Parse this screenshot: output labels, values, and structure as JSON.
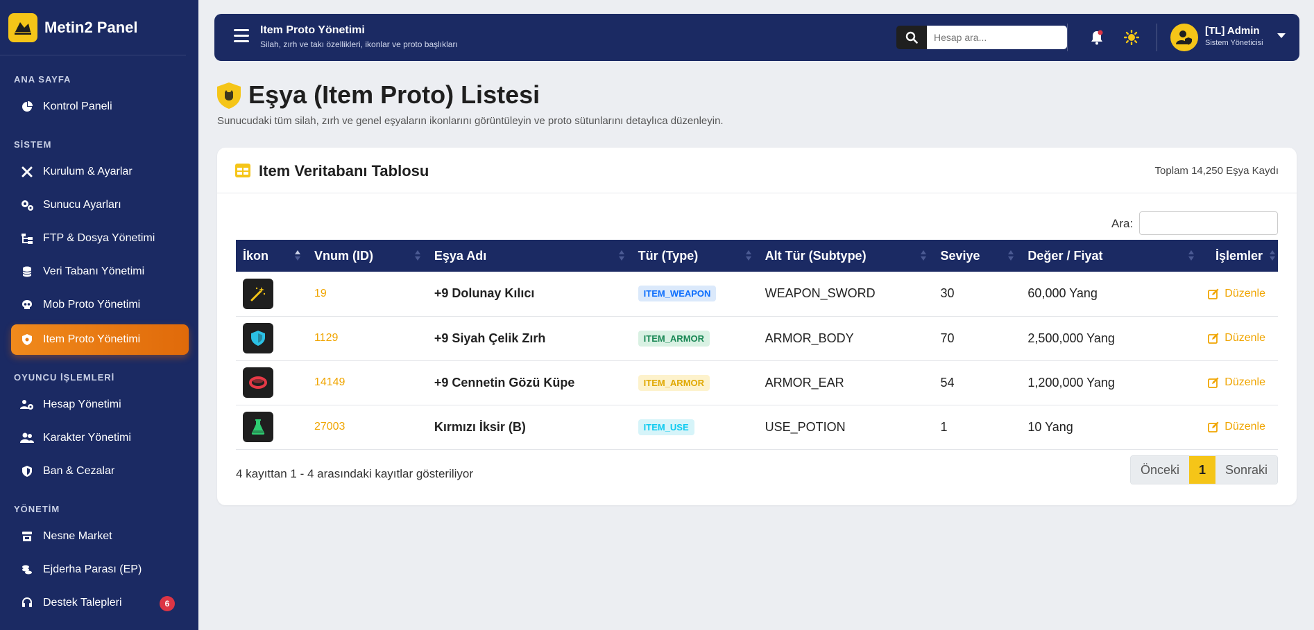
{
  "brand": {
    "name": "Metin2 Panel"
  },
  "sidebar": {
    "sections": [
      {
        "label": "ANA SAYFA"
      },
      {
        "label": "SİSTEM"
      },
      {
        "label": "OYUNCU İŞLEMLERİ"
      },
      {
        "label": "YÖNETİM"
      }
    ],
    "items": [
      {
        "label": "Kontrol Paneli",
        "icon": "chart-pie-icon"
      },
      {
        "label": "Kurulum & Ayarlar",
        "icon": "tools-icon"
      },
      {
        "label": "Sunucu Ayarları",
        "icon": "gears-icon"
      },
      {
        "label": "FTP & Dosya Yönetimi",
        "icon": "folder-tree-icon"
      },
      {
        "label": "Veri Tabanı Yönetimi",
        "icon": "database-icon"
      },
      {
        "label": "Mob Proto Yönetimi",
        "icon": "skull-icon"
      },
      {
        "label": "Item Proto Yönetimi",
        "icon": "shield-cat-icon",
        "active": true
      },
      {
        "label": "Hesap Yönetimi",
        "icon": "users-gear-icon"
      },
      {
        "label": "Karakter Yönetimi",
        "icon": "user-group-icon"
      },
      {
        "label": "Ban & Cezalar",
        "icon": "shield-half-icon"
      },
      {
        "label": "Nesne Market",
        "icon": "store-icon"
      },
      {
        "label": "Ejderha Parası (EP)",
        "icon": "coins-icon"
      },
      {
        "label": "Destek Talepleri",
        "icon": "headset-icon",
        "badge": "6"
      }
    ]
  },
  "topbar": {
    "title": "Item Proto Yönetimi",
    "subtitle": "Silah, zırh ve takı özellikleri, ikonlar ve proto başlıkları",
    "search_placeholder": "Hesap ara...",
    "user_name": "[TL] Admin",
    "user_role": "Sistem Yöneticisi"
  },
  "page": {
    "title": "Eşya (Item Proto) Listesi",
    "description": "Sunucudaki tüm silah, zırh ve genel eşyaların ikonlarını görüntüleyin ve proto sütunlarını detaylıca düzenleyin."
  },
  "card": {
    "title": "Item Veritabanı Tablosu",
    "count": "Toplam 14,250 Eşya Kaydı",
    "filter_label": "Ara:"
  },
  "table": {
    "headers": [
      "İkon",
      "Vnum (ID)",
      "Eşya Adı",
      "Tür (Type)",
      "Alt Tür (Subtype)",
      "Seviye",
      "Değer / Fiyat",
      "İşlemler"
    ],
    "rows": [
      {
        "icon": "magic-wand-icon",
        "vnum": "19",
        "name": "+9 Dolunay Kılıcı",
        "type": "ITEM_WEAPON",
        "subtype": "WEAPON_SWORD",
        "level": "30",
        "price": "60,000 Yang",
        "action": "Düzenle"
      },
      {
        "icon": "shield-icon",
        "vnum": "1129",
        "name": "+9 Siyah Çelik Zırh",
        "type": "ITEM_ARMOR",
        "subtype": "ARMOR_BODY",
        "level": "70",
        "price": "2,500,000 Yang",
        "action": "Düzenle"
      },
      {
        "icon": "ring-icon",
        "vnum": "14149",
        "name": "+9 Cennetin Gözü Küpe",
        "type": "ITEM_ARMOR",
        "subtype": "ARMOR_EAR",
        "level": "54",
        "price": "1,200,000 Yang",
        "action": "Düzenle"
      },
      {
        "icon": "flask-icon",
        "vnum": "27003",
        "name": "Kırmızı İksir (B)",
        "type": "ITEM_USE",
        "subtype": "USE_POTION",
        "level": "1",
        "price": "10 Yang",
        "action": "Düzenle"
      }
    ]
  },
  "footer": {
    "info": "4 kayıttan 1 - 4 arasındaki kayıtlar gösteriliyor",
    "prev": "Önceki",
    "page": "1",
    "next": "Sonraki"
  },
  "colors": {
    "navy": "#1b2a63",
    "accent": "#f5c518",
    "active_nav": "#e8780f",
    "link": "#f0a500",
    "badge_red": "#dc3545"
  }
}
